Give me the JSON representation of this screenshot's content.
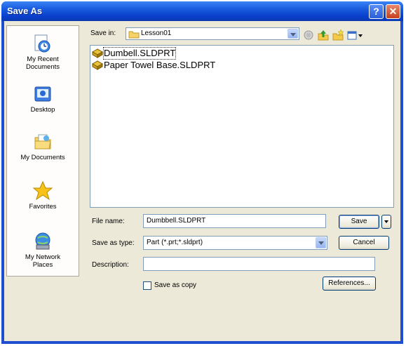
{
  "window": {
    "title": "Save As"
  },
  "titlebar_buttons": {
    "help": "?",
    "close": "✕"
  },
  "places": [
    {
      "label": "My Recent\nDocuments",
      "icon": "recent-documents-icon"
    },
    {
      "label": "Desktop",
      "icon": "desktop-icon"
    },
    {
      "label": "My Documents",
      "icon": "my-documents-icon"
    },
    {
      "label": "Favorites",
      "icon": "favorites-star-icon"
    },
    {
      "label": "My Network\nPlaces",
      "icon": "network-places-icon"
    }
  ],
  "save_in": {
    "label": "Save in:",
    "value": "Lesson01"
  },
  "toolbar": {
    "icons": [
      "back-icon",
      "up-folder-icon",
      "new-folder-icon",
      "views-menu-icon"
    ]
  },
  "files": [
    {
      "name": "Dumbell.SLDPRT",
      "selected": true
    },
    {
      "name": "Paper Towel Base.SLDPRT",
      "selected": false
    }
  ],
  "form": {
    "file_name_label": "File name:",
    "file_name_value": "Dumbbell.SLDPRT",
    "save_as_type_label": "Save as type:",
    "save_as_type_value": "Part (*.prt;*.sldprt)",
    "description_label": "Description:",
    "description_value": "",
    "save_as_copy_label": "Save as copy",
    "save_as_copy_checked": false
  },
  "buttons": {
    "save": "Save",
    "cancel": "Cancel",
    "references": "References..."
  },
  "colors": {
    "title_bar": "#0a3fcc",
    "dialog_bg": "#ece9d8",
    "field_border": "#7f9db9"
  }
}
